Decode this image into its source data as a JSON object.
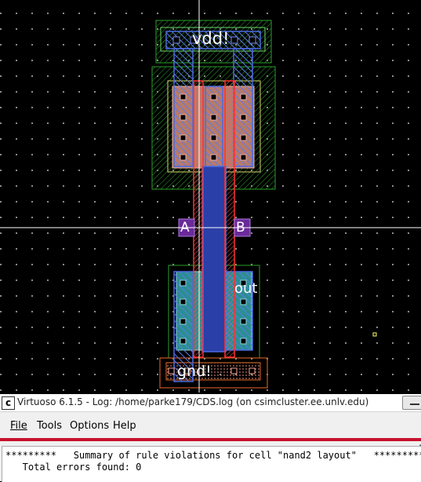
{
  "layout": {
    "labels": {
      "vdd": "vdd!",
      "gnd": "gnd!",
      "out": "out",
      "a": "A",
      "b": "B"
    }
  },
  "window": {
    "title": "Virtuoso 6.1.5 - Log: /home/parke179/CDS.log (on csimcluster.ee.unlv.edu)",
    "app_icon": "c",
    "logo_text": "cā"
  },
  "menu": {
    "file": "File",
    "tools": "Tools",
    "options": "Options",
    "help": "Help"
  },
  "log": {
    "lines": [
      "*********   Summary of rule violations for cell \"nand2 layout\"   *********",
      "   Total errors found: 0"
    ]
  },
  "colors": {
    "metal1": "#3b5bd6",
    "poly": "#e0202a",
    "nwell": "#2aa02a",
    "pselect": "#e86a2a",
    "via": "#000000"
  }
}
